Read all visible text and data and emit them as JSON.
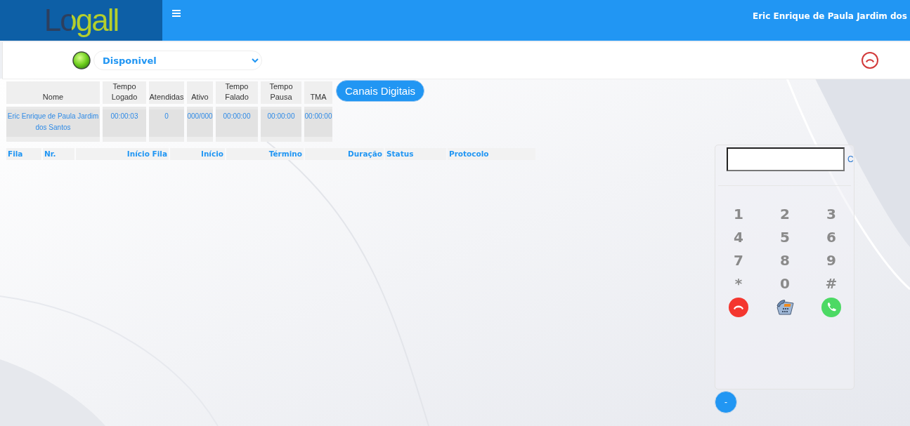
{
  "header": {
    "logo": "Logall",
    "user_name": "Eric Enrique de Paula Jardim dos"
  },
  "status": {
    "label": "Disponivel"
  },
  "agent_table": {
    "columns": [
      "Nome",
      "Tempo\nLogado",
      "Atendidas",
      "Ativo",
      "Tempo\nFalado",
      "Tempo\nPausa",
      "TMA"
    ],
    "rows": [
      [
        "Eric Enrique de Paula Jardim dos Santos",
        "00:00:03",
        "0",
        "000/000",
        "00:00:00",
        "00:00:00",
        "00:00:00"
      ]
    ]
  },
  "canais_button": "Canais Digitais",
  "queue_table": {
    "columns": [
      "Fila",
      "Nr.",
      "Início Fila",
      "Início",
      "Término",
      "Duração",
      "Status",
      "Protocolo"
    ]
  },
  "dialer": {
    "clear": "C",
    "keys": [
      "1",
      "2",
      "3",
      "4",
      "5",
      "6",
      "7",
      "8",
      "9",
      "*",
      "0",
      "#"
    ],
    "collapse": "-"
  }
}
